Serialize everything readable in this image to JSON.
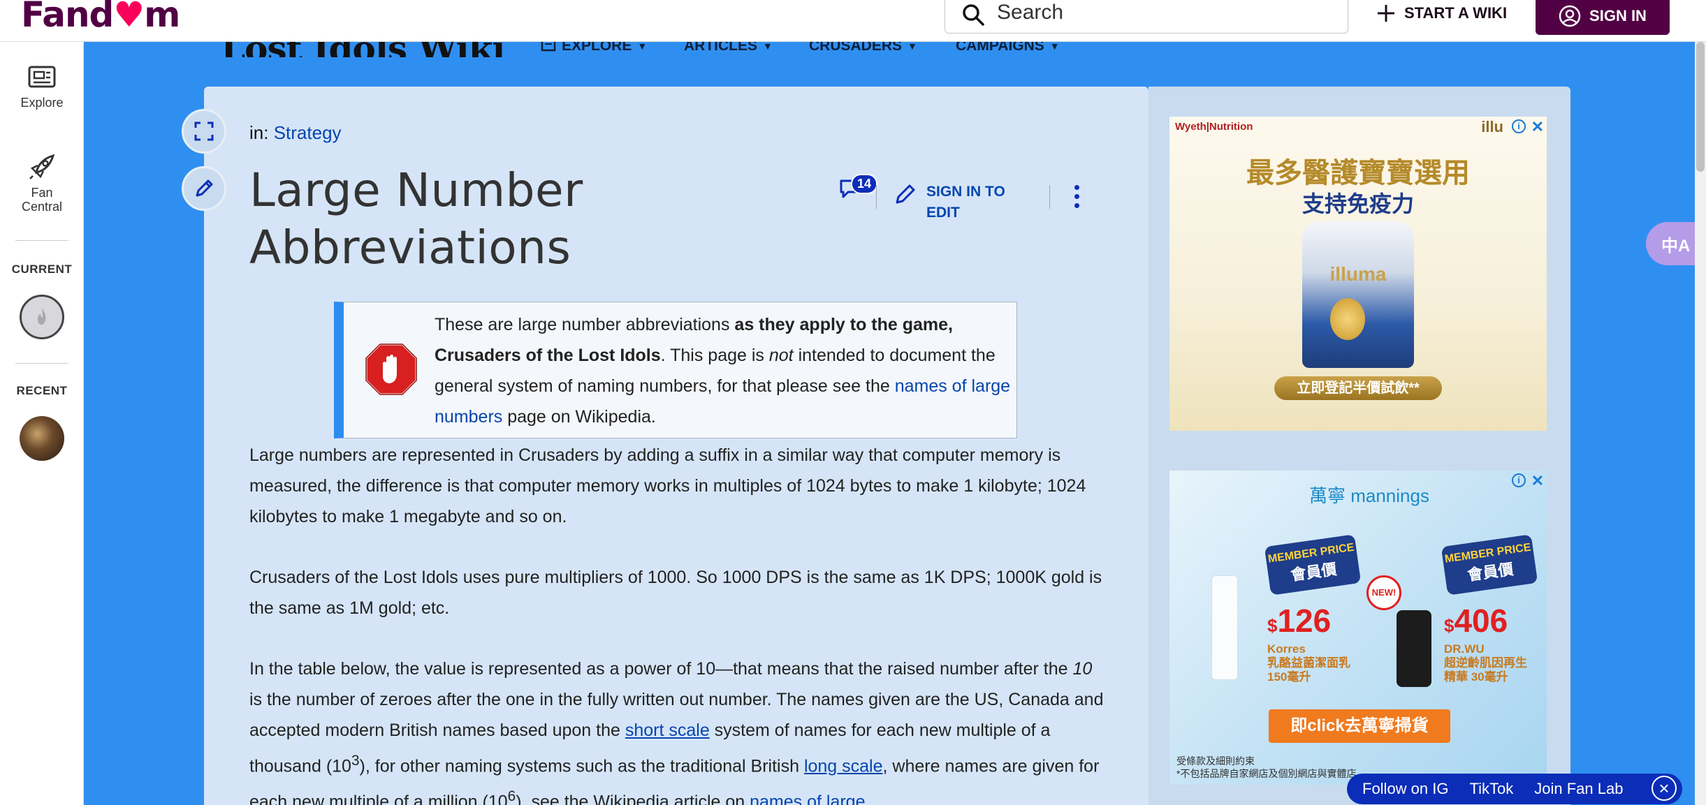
{
  "topbar": {
    "logo_text_a": "Fand",
    "logo_text_b": "m",
    "search_placeholder": "Search",
    "start_wiki_label": "START A WIKI",
    "sign_in_label": "SIGN IN"
  },
  "leftrail": {
    "explore_label": "Explore",
    "fan_central_label_1": "Fan",
    "fan_central_label_2": "Central",
    "current_heading": "CURRENT",
    "recent_heading": "RECENT"
  },
  "wiki": {
    "title": "Lost Idols Wiki",
    "nav": [
      {
        "label": "EXPLORE"
      },
      {
        "label": "ARTICLES"
      },
      {
        "label": "CRUSADERS"
      },
      {
        "label": "CAMPAIGNS"
      }
    ]
  },
  "article": {
    "breadcrumb_prefix": "in:",
    "breadcrumb_category": "Strategy",
    "title": "Large Number Abbreviations",
    "comment_count": "14",
    "sign_in_to_edit": "SIGN IN TO EDIT",
    "notice": {
      "t1": "These are large number abbreviations ",
      "t2": "as they apply to the game, Crusaders of the Lost Idols",
      "t3": ". This page is ",
      "t4": "not",
      "t5": " intended to document the general system of naming numbers, for that please see the ",
      "link": "names of large numbers",
      "t6": " page on Wikipedia."
    },
    "para1": "Large numbers are represented in Crusaders by adding a suffix in a similar way that computer memory is measured, the difference is that computer memory works in multiples of 1024 bytes to make 1 kilobyte; 1024 kilobytes to make 1 megabyte and so on.",
    "para2": "Crusaders of the Lost Idols uses pure multipliers of 1000. So 1000 DPS is the same as 1K DPS; 1000K gold is the same as 1M gold; etc.",
    "para3": {
      "a": "In the table below, the value is represented as a power of 10—that means that the raised number after the ",
      "b": "10",
      "c": " is the number of zeroes after the one in the fully written out number. The names given are the US, Canada and accepted modern British names based upon the ",
      "link1": "short scale",
      "d": " system of names for each new multiple of a thousand (10",
      "sup1": "3",
      "e": "), for other naming systems such as the traditional British ",
      "link2": "long scale",
      "f": ", where names are given for each new multiple of a million (10",
      "sup2": "6",
      "g": "), see the Wikipedia article on ",
      "link3": "names of large"
    }
  },
  "ads": {
    "ad1": {
      "brand": "Wyeth|Nutrition",
      "brand2": "illu",
      "headline": "最多醫護寶寶選用",
      "sub": "支持免疫力",
      "product": "illuma",
      "cta": "立即登記半價試飲**"
    },
    "ad2": {
      "brand": "萬寧 mannings",
      "badge": "MEMBER PRICE",
      "badge2": "會員價",
      "price1": "126",
      "product1a": "Korres",
      "product1b": "乳酪益菌潔面乳",
      "product1c": "150毫升",
      "new_badge": "NEW!",
      "price2": "406",
      "product2a": "DR.WU",
      "product2b": "超逆齡肌因再生",
      "product2c": "精華 30毫升",
      "cta": "即click去萬寧掃貨",
      "fine1": "受條款及細則約束",
      "fine2": "*不包括品牌自家網店及個別網店與實體店"
    }
  },
  "follow_bar": {
    "ig": "Follow on IG",
    "tiktok": "TikTok",
    "fanlab": "Join Fan Lab"
  },
  "translate_label": "中A"
}
